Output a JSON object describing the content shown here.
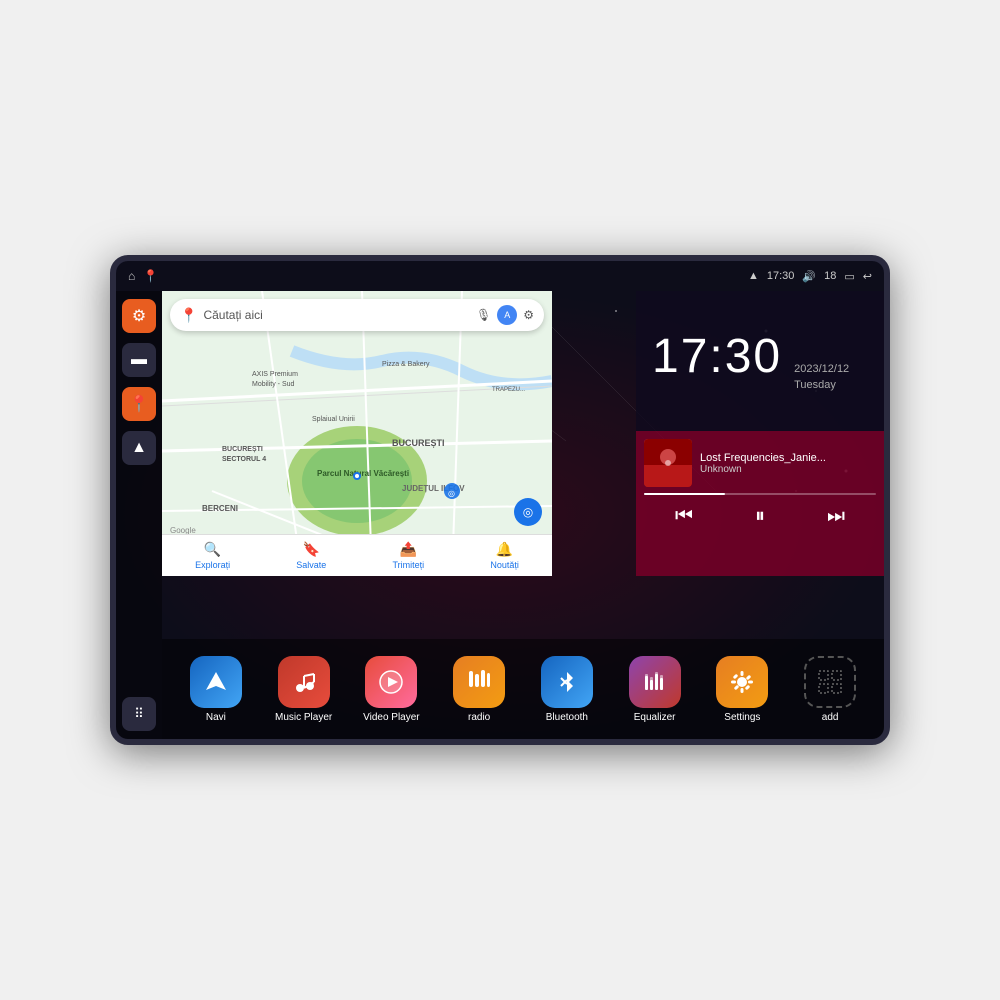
{
  "device": {
    "status_bar": {
      "wifi_icon": "▲",
      "time": "17:30",
      "volume_icon": "🔊",
      "battery_level": "18",
      "battery_icon": "🔋",
      "back_icon": "↩"
    },
    "clock": {
      "time": "17:30",
      "date": "2023/12/12",
      "day": "Tuesday"
    },
    "map": {
      "search_placeholder": "Căutați aici",
      "bottom_items": [
        {
          "label": "Explorați",
          "icon": "🔍"
        },
        {
          "label": "Salvate",
          "icon": "🔖"
        },
        {
          "label": "Trimiteți",
          "icon": "📤"
        },
        {
          "label": "Noutăți",
          "icon": "🔔"
        }
      ],
      "location_label": "Parcul Natural Văcărești",
      "area_label": "BUCUREȘTI",
      "sector_label": "BUCUREȘTI SECTORUL 4",
      "district_label": "JUDEȚUL ILFOV",
      "berceni_label": "BERCENI"
    },
    "music": {
      "title": "Lost Frequencies_Janie...",
      "artist": "Unknown",
      "progress": 35
    },
    "sidebar": {
      "items": [
        {
          "icon": "⚙",
          "label": "settings"
        },
        {
          "icon": "📁",
          "label": "files"
        },
        {
          "icon": "📍",
          "label": "map"
        },
        {
          "icon": "▲",
          "label": "navigation"
        },
        {
          "icon": "⋮⋮⋮",
          "label": "apps"
        }
      ]
    },
    "apps": [
      {
        "label": "Navi",
        "icon": "▲",
        "color": "navi"
      },
      {
        "label": "Music Player",
        "icon": "♪",
        "color": "music"
      },
      {
        "label": "Video Player",
        "icon": "▶",
        "color": "video"
      },
      {
        "label": "radio",
        "icon": "📻",
        "color": "radio"
      },
      {
        "label": "Bluetooth",
        "icon": "⚡",
        "color": "bluetooth"
      },
      {
        "label": "Equalizer",
        "icon": "≋",
        "color": "equalizer"
      },
      {
        "label": "Settings",
        "icon": "⚙",
        "color": "settings"
      },
      {
        "label": "add",
        "icon": "+",
        "color": "add"
      }
    ]
  }
}
